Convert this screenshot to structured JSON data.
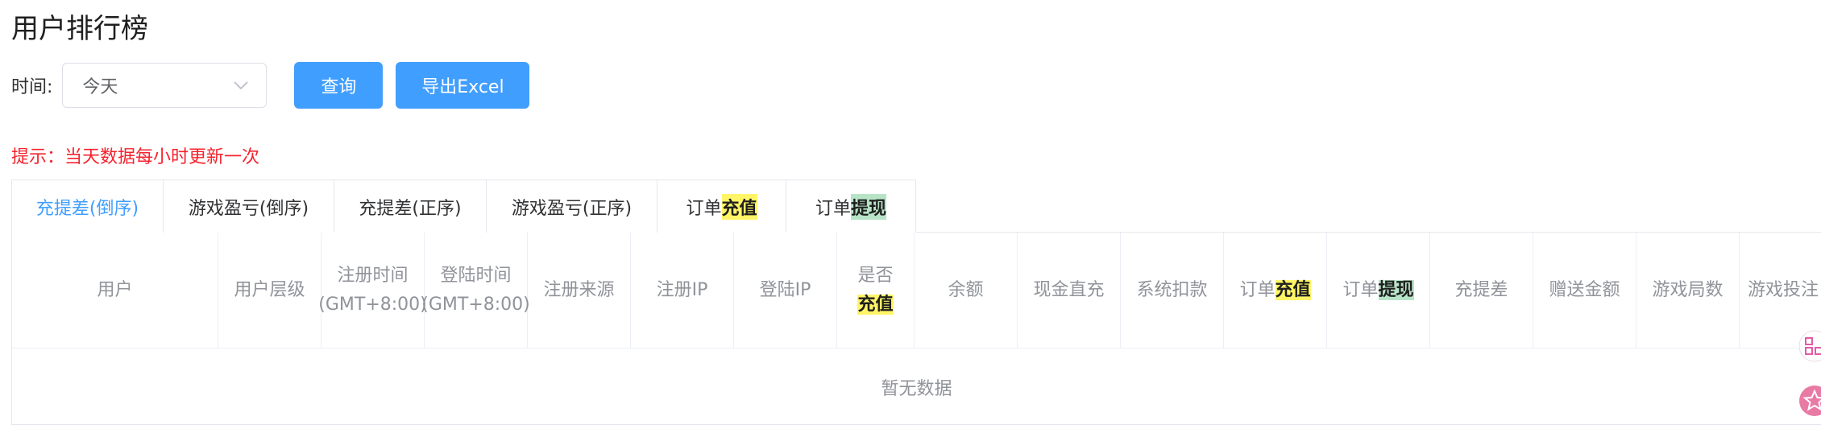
{
  "page": {
    "title": "用户排行榜"
  },
  "filter": {
    "time_label": "时间:",
    "time_value": "今天",
    "query_label": "查询",
    "export_label": "导出Excel"
  },
  "hint": "提示：当天数据每小时更新一次",
  "tabs": [
    {
      "label": "充提差(倒序)"
    },
    {
      "label": "游戏盈亏(倒序)"
    },
    {
      "label": "充提差(正序)"
    },
    {
      "label": "游戏盈亏(正序)"
    },
    {
      "prefix": "订单",
      "highlight": "充值"
    },
    {
      "prefix": "订单",
      "highlight": "提现"
    }
  ],
  "table": {
    "columns": [
      {
        "label": "用户"
      },
      {
        "label": "用户层级"
      },
      {
        "label": "注册时间(GMT+8:00)"
      },
      {
        "label": "登陆时间(GMT+8:00)"
      },
      {
        "label": "注册来源"
      },
      {
        "label": "注册IP"
      },
      {
        "label": "登陆IP"
      },
      {
        "prefix": "是否",
        "highlight": "充值"
      },
      {
        "label": "余额"
      },
      {
        "label": "现金直充"
      },
      {
        "label": "系统扣款"
      },
      {
        "prefix": "订单",
        "highlight": "充值"
      },
      {
        "prefix": "订单",
        "highlight": "提现"
      },
      {
        "label": "充提差"
      },
      {
        "label": "赠送金额"
      },
      {
        "label": "游戏局数"
      },
      {
        "label": "游戏投注"
      }
    ],
    "empty_text": "暂无数据"
  },
  "colors": {
    "primary": "#409eff",
    "hint": "#f5222d",
    "highlight_yellow": "#fff566",
    "highlight_green": "#b7e4c7"
  }
}
